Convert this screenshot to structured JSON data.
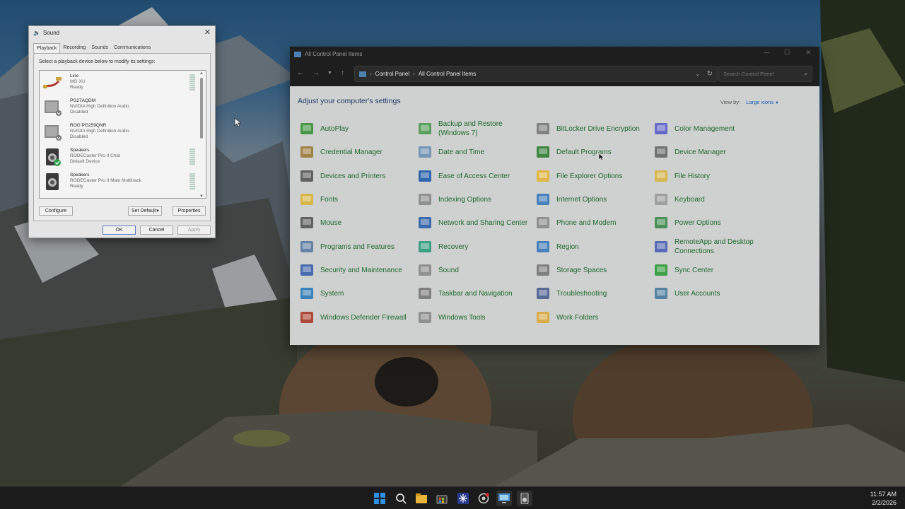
{
  "sound_dialog": {
    "title": "Sound",
    "tabs": [
      "Playback",
      "Recording",
      "Sounds",
      "Communications"
    ],
    "instruction": "Select a playback device below to modify its settings:",
    "devices": [
      {
        "name": "Line",
        "driver": "MG-XU",
        "status": "Ready",
        "icon": "line-in-icon"
      },
      {
        "name": "PG27AQDM",
        "driver": "NVIDIA High Definition Audio",
        "status": "Disabled",
        "icon": "monitor-speaker-icon"
      },
      {
        "name": "ROG PG259QNR",
        "driver": "NVIDIA High Definition Audio",
        "status": "Disabled",
        "icon": "monitor-speaker-icon"
      },
      {
        "name": "Speakers",
        "driver": "RODECaster Pro II Chat",
        "status": "Default Device",
        "icon": "speaker-icon"
      },
      {
        "name": "Speakers",
        "driver": "RODECaster Pro II Main Multitrack",
        "status": "Ready",
        "icon": "speaker-icon"
      }
    ],
    "buttons": {
      "configure": "Configure",
      "set_default": "Set Default",
      "properties": "Properties",
      "ok": "OK",
      "cancel": "Cancel",
      "apply": "Apply"
    }
  },
  "control_panel": {
    "window_title": "All Control Panel Items",
    "breadcrumb": [
      "Control Panel",
      "All Control Panel Items"
    ],
    "search_placeholder": "Search Control Panel",
    "heading": "Adjust your computer's settings",
    "view_by_label": "View by:",
    "view_by_value": "Large icons",
    "items": [
      {
        "label": "AutoPlay",
        "icon": "autoplay-icon"
      },
      {
        "label": "Backup and Restore (Windows 7)",
        "icon": "backup-icon"
      },
      {
        "label": "BitLocker Drive Encryption",
        "icon": "bitlocker-icon"
      },
      {
        "label": "Color Management",
        "icon": "color-management-icon"
      },
      {
        "label": "Credential Manager",
        "icon": "credential-icon"
      },
      {
        "label": "Date and Time",
        "icon": "clock-icon"
      },
      {
        "label": "Default Programs",
        "icon": "default-programs-icon"
      },
      {
        "label": "Device Manager",
        "icon": "device-manager-icon"
      },
      {
        "label": "Devices and Printers",
        "icon": "printer-icon"
      },
      {
        "label": "Ease of Access Center",
        "icon": "ease-of-access-icon"
      },
      {
        "label": "File Explorer Options",
        "icon": "folder-options-icon"
      },
      {
        "label": "File History",
        "icon": "file-history-icon"
      },
      {
        "label": "Fonts",
        "icon": "fonts-icon"
      },
      {
        "label": "Indexing Options",
        "icon": "indexing-icon"
      },
      {
        "label": "Internet Options",
        "icon": "internet-options-icon"
      },
      {
        "label": "Keyboard",
        "icon": "keyboard-icon"
      },
      {
        "label": "Mouse",
        "icon": "mouse-icon"
      },
      {
        "label": "Network and Sharing Center",
        "icon": "network-icon"
      },
      {
        "label": "Phone and Modem",
        "icon": "phone-icon"
      },
      {
        "label": "Power Options",
        "icon": "power-icon"
      },
      {
        "label": "Programs and Features",
        "icon": "programs-icon"
      },
      {
        "label": "Recovery",
        "icon": "recovery-icon"
      },
      {
        "label": "Region",
        "icon": "region-icon"
      },
      {
        "label": "RemoteApp and Desktop Connections",
        "icon": "remoteapp-icon"
      },
      {
        "label": "Security and Maintenance",
        "icon": "flag-icon"
      },
      {
        "label": "Sound",
        "icon": "sound-icon"
      },
      {
        "label": "Storage Spaces",
        "icon": "storage-icon"
      },
      {
        "label": "Sync Center",
        "icon": "sync-icon"
      },
      {
        "label": "System",
        "icon": "system-icon"
      },
      {
        "label": "Taskbar and Navigation",
        "icon": "taskbar-icon"
      },
      {
        "label": "Troubleshooting",
        "icon": "troubleshooting-icon"
      },
      {
        "label": "User Accounts",
        "icon": "user-accounts-icon"
      },
      {
        "label": "Windows Defender Firewall",
        "icon": "firewall-icon"
      },
      {
        "label": "Windows Tools",
        "icon": "tools-icon"
      },
      {
        "label": "Work Folders",
        "icon": "work-folders-icon"
      }
    ]
  },
  "taskbar": {
    "icons": [
      "start-icon",
      "search-icon",
      "file-explorer-icon",
      "store-icon",
      "app-icon",
      "browser-icon",
      "control-panel-icon",
      "sound-settings-icon"
    ],
    "time": "11:57 AM",
    "date": "2/2/2026"
  }
}
